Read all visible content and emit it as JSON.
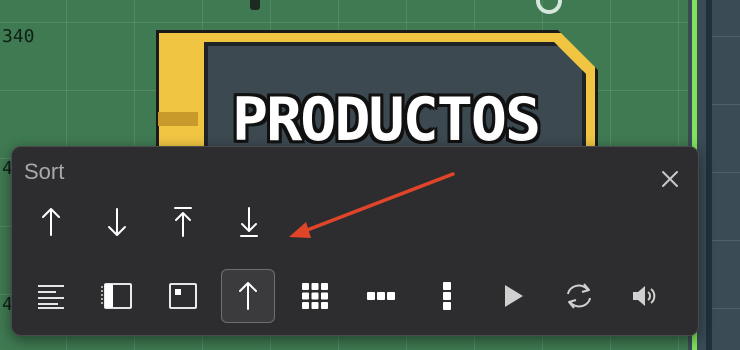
{
  "canvas": {
    "ruler_labels": [
      "340",
      "4",
      "4"
    ],
    "sign_text": "PRODUCTOS",
    "background_color": "#3f7a52",
    "sign_color": "#f0c542"
  },
  "sort_panel": {
    "title": "Sort",
    "close_icon": "close-icon",
    "sort_buttons": [
      {
        "icon": "arrow-up-icon"
      },
      {
        "icon": "arrow-down-icon"
      },
      {
        "icon": "arrow-up-to-top-icon"
      },
      {
        "icon": "arrow-down-to-bottom-icon"
      }
    ],
    "toolbar_buttons": [
      {
        "icon": "align-left-lines-icon",
        "selected": false
      },
      {
        "icon": "sidebar-panel-icon",
        "selected": false
      },
      {
        "icon": "image-frame-icon",
        "selected": false
      },
      {
        "icon": "arrow-up-icon",
        "selected": true
      },
      {
        "icon": "grid-icon",
        "selected": false
      },
      {
        "icon": "horizontal-dots-icon",
        "selected": false
      },
      {
        "icon": "vertical-dots-icon",
        "selected": false
      },
      {
        "icon": "play-icon",
        "selected": false
      },
      {
        "icon": "refresh-icon",
        "selected": false
      },
      {
        "icon": "speaker-icon",
        "selected": false
      }
    ],
    "accent_color": "#e0452a"
  }
}
